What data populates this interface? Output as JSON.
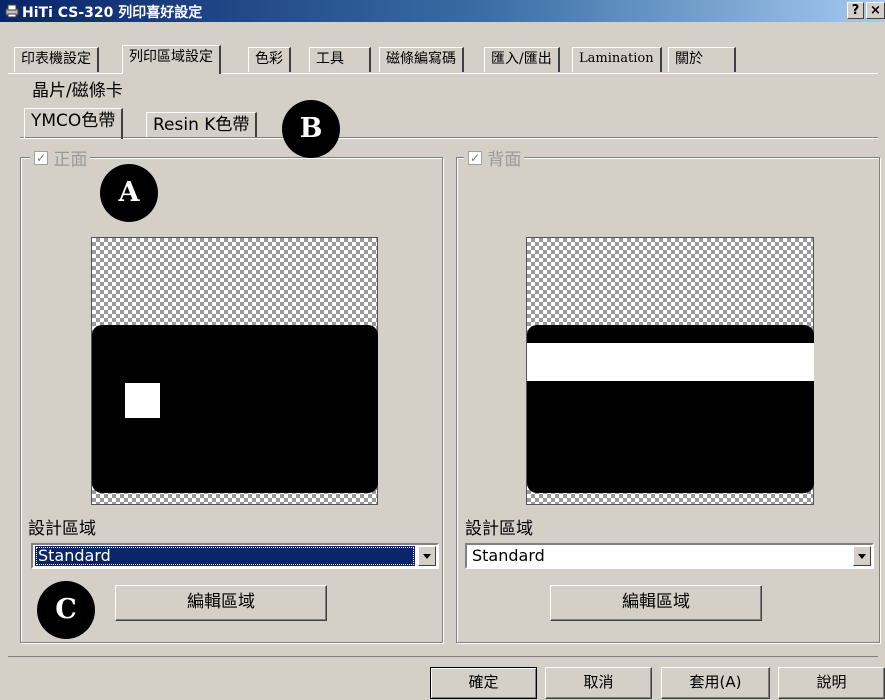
{
  "window": {
    "title": "HiTi CS-320 列印喜好設定",
    "help_button": "?",
    "close_button": "×"
  },
  "main_tabs": [
    {
      "label": "印表機設定",
      "active": false
    },
    {
      "label": "列印區域設定",
      "active": true
    },
    {
      "label": "色彩",
      "active": false
    },
    {
      "label": "工具",
      "active": false
    },
    {
      "label": "磁條編寫碼",
      "active": false
    },
    {
      "label": "匯入/匯出",
      "active": false
    },
    {
      "label": "Lamination",
      "active": false
    },
    {
      "label": "關於",
      "active": false
    }
  ],
  "section_title": "晶片/磁條卡",
  "sub_tabs": [
    {
      "label": "YMCO色帶",
      "active": true
    },
    {
      "label": "Resin K色帶",
      "active": false
    }
  ],
  "front": {
    "legend": "正面",
    "checked": true,
    "design_area_label": "設計區域",
    "dropdown_value": "Standard",
    "edit_button": "編輯區域"
  },
  "back": {
    "legend": "背面",
    "checked": true,
    "design_area_label": "設計區域",
    "dropdown_value": "Standard",
    "edit_button": "編輯區域"
  },
  "markers": {
    "a": "A",
    "b": "B",
    "c": "C"
  },
  "footer": {
    "ok": "確定",
    "cancel": "取消",
    "apply": "套用(A)",
    "help": "說明"
  },
  "colors": {
    "title_bar_start": "#0a246a",
    "dialog_bg": "#d4d0c8",
    "selection": "#0a246a"
  }
}
